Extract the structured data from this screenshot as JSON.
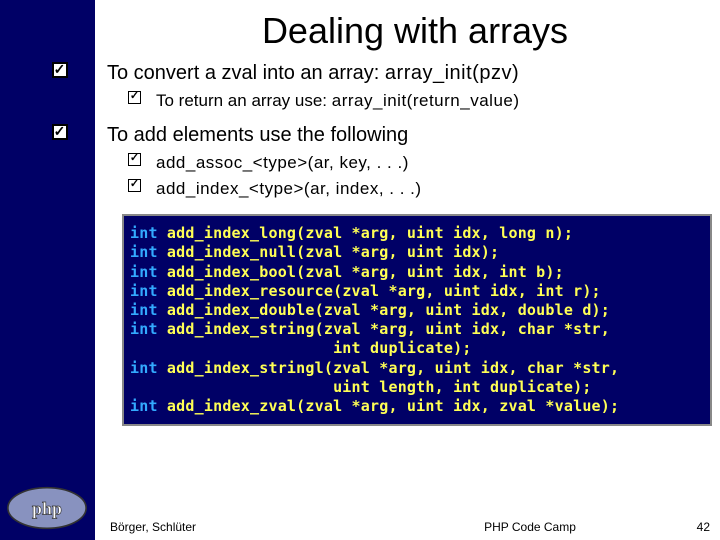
{
  "title": "Dealing with arrays",
  "bullets": {
    "b1_pre": "To convert a zval into an array: ",
    "b1_code": "array_init(pzv)",
    "b1a_pre": "To return an array use: ",
    "b1a_code": "array_init(return_value)",
    "b2": "To add elements use the following",
    "b2a": "add_assoc_<type>(ar, key, . . .)",
    "b2b": "add_index_<type>(ar, index, . . .)"
  },
  "code": {
    "kw": "int",
    "l1": " add_index_long(zval *arg, uint idx, long n);",
    "l2": " add_index_null(zval *arg, uint idx);",
    "l3": " add_index_bool(zval *arg, uint idx, int b);",
    "l4": " add_index_resource(zval *arg, uint idx, int r);",
    "l5": " add_index_double(zval *arg, uint idx, double d);",
    "l6": " add_index_string(zval *arg, uint idx, char *str,",
    "l6b": "                      int duplicate);",
    "l7": " add_index_stringl(zval *arg, uint idx, char *str,",
    "l7b": "                      uint length, int duplicate);",
    "l8": " add_index_zval(zval *arg, uint idx, zval *value);"
  },
  "footer": {
    "left": "Börger, Schlüter",
    "center": "PHP Code Camp",
    "right": "42"
  }
}
